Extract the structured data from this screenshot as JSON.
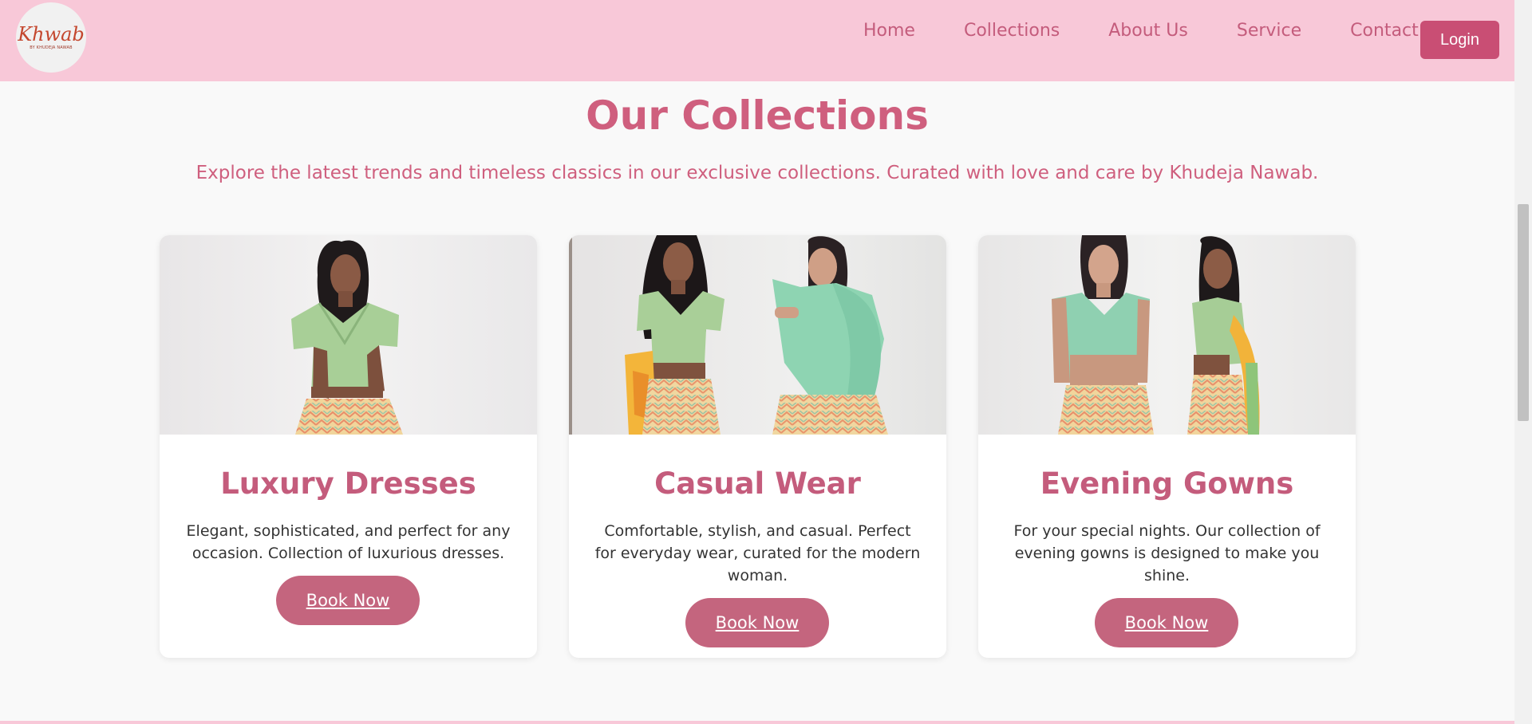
{
  "brand": {
    "logo_text": "Khwab",
    "logo_subtext": "BY KHUDEJA NAWAB"
  },
  "nav": {
    "items": [
      {
        "label": "Home"
      },
      {
        "label": "Collections"
      },
      {
        "label": "About Us"
      },
      {
        "label": "Service"
      },
      {
        "label": "Contact"
      }
    ],
    "login_label": "Login"
  },
  "hero": {
    "title": "Our Collections",
    "subtitle": "Explore the latest trends and timeless classics in our exclusive collections. Curated with love and care by Khudeja Nawab."
  },
  "cards": [
    {
      "title": "Luxury Dresses",
      "description": "Elegant, sophisticated, and perfect for any occasion. Collection of luxurious dresses.",
      "button_label": "Book Now"
    },
    {
      "title": "Casual Wear",
      "description": "Comfortable, stylish, and casual. Perfect for everyday wear, curated for the modern woman.",
      "button_label": "Book Now"
    },
    {
      "title": "Evening Gowns",
      "description": "For your special nights. Our collection of evening gowns is designed to make you shine.",
      "button_label": "Book Now"
    }
  ],
  "colors": {
    "header_bg": "#f8c8d8",
    "accent": "#c94e74",
    "title_pink": "#cf5f7e",
    "button_pink": "#c4657e"
  }
}
